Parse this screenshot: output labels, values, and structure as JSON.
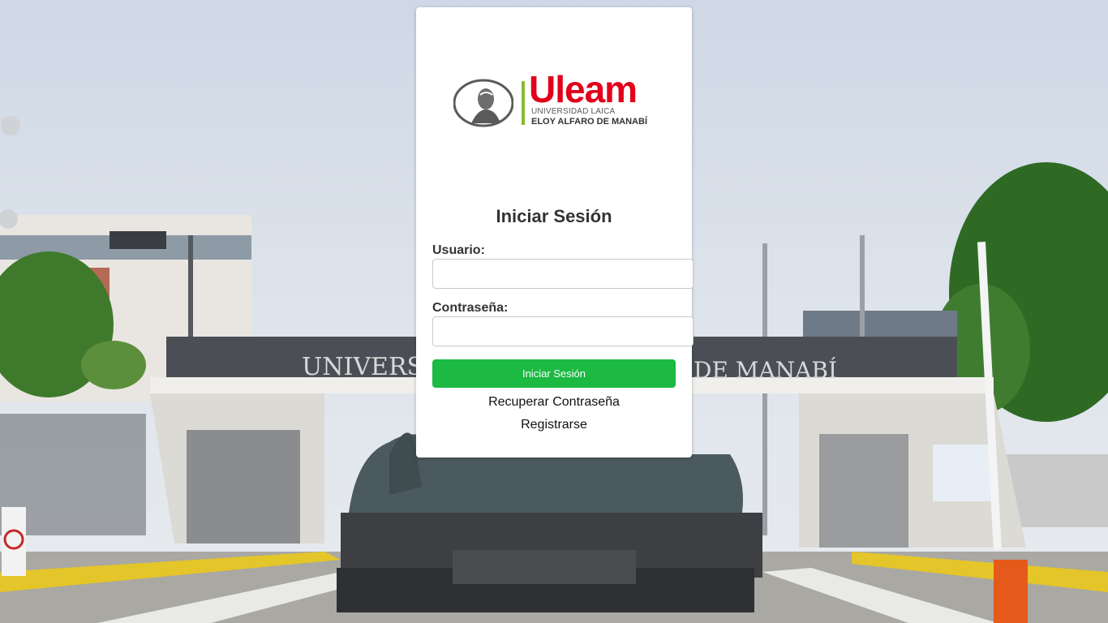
{
  "colors": {
    "primary_button": "#1cb943",
    "brand_red": "#e2001a",
    "brand_green": "#8ab934"
  },
  "logo": {
    "brand": "Uleam",
    "line1": "UNIVERSIDAD LAICA",
    "line2": "ELOY ALFARO DE MANABÍ",
    "emblem": "founder-portrait-emblem"
  },
  "background": {
    "gate_text_left": "UNIVERSID",
    "gate_text_right": "DE MANABÍ"
  },
  "login": {
    "title": "Iniciar Sesión",
    "username_label": "Usuario:",
    "username_value": "",
    "password_label": "Contraseña:",
    "password_value": "",
    "submit_label": "Iniciar Sesión",
    "recover_link": "Recuperar Contraseña",
    "register_link": "Registrarse"
  }
}
